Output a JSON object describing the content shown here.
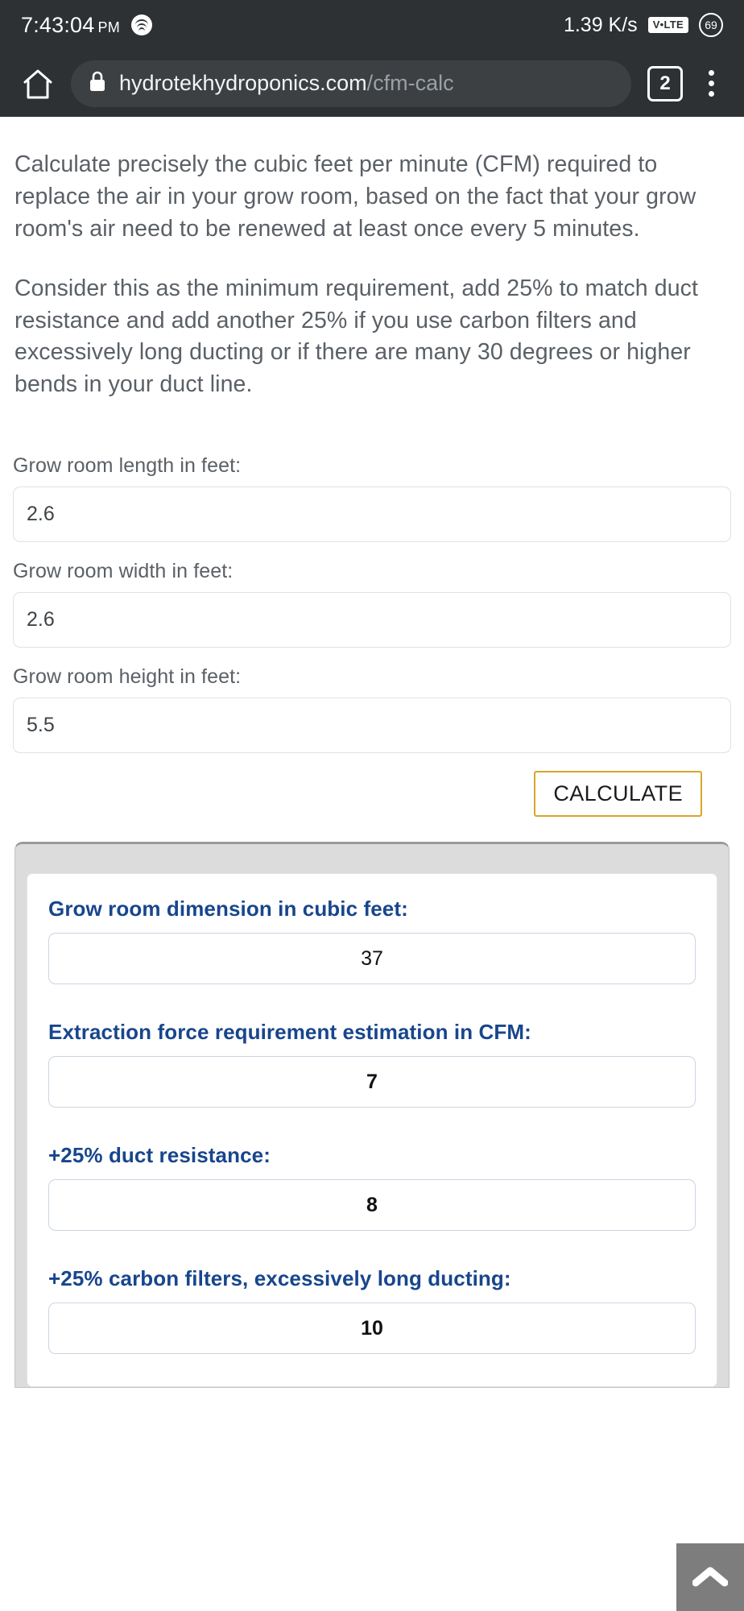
{
  "statusbar": {
    "time": "7:43:04",
    "ampm": "PM",
    "music_icon": "spotify-icon",
    "network_speed": "1.39 K/s",
    "volte": "V•LTE",
    "battery": "69"
  },
  "browser": {
    "home_icon": "home-icon",
    "lock_icon": "lock-icon",
    "url_domain": "hydrotekhydroponics.com",
    "url_path": "/cfm-calc",
    "tab_count": "2",
    "menu_icon": "kebab-menu-icon"
  },
  "content": {
    "paragraphs": [
      "Calculate precisely the cubic feet per minute (CFM) required to replace the air in your grow room, based on the fact that your grow room's air need to be renewed at least once every 5 minutes.",
      "Consider this as the minimum requirement, add 25% to match duct resistance and add another 25% if you use carbon filters and excessively long ducting or if there are many 30 degrees or higher bends in your duct line."
    ]
  },
  "form": {
    "fields": [
      {
        "label": "Grow room length in feet:",
        "value": "2.6",
        "name": "length"
      },
      {
        "label": "Grow room width in feet:",
        "value": "2.6",
        "name": "width"
      },
      {
        "label": "Grow room height in feet:",
        "value": "5.5",
        "name": "height"
      }
    ],
    "calculate_label": "CALCULATE",
    "calculate_border_color": "#d8a62b"
  },
  "results": {
    "label_color": "#18468c",
    "items": [
      {
        "label": "Grow room dimension in cubic feet:",
        "value": "37",
        "bold": false
      },
      {
        "label": "Extraction force requirement estimation in CFM:",
        "value": "7",
        "bold": true
      },
      {
        "label": "+25% duct resistance:",
        "value": "8",
        "bold": true
      },
      {
        "label": "+25% carbon filters, excessively long ducting:",
        "value": "10",
        "bold": true
      }
    ]
  },
  "scroll_top": {
    "icon": "chevron-up-icon",
    "background": "#7d7d7d"
  }
}
